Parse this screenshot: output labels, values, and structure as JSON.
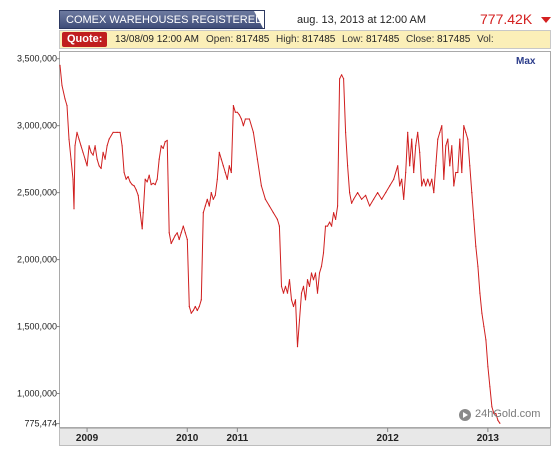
{
  "header": {
    "title": "COMEX WAREHOUSES REGISTERED S",
    "datetime": "aug. 13, 2013 at 12:00 AM",
    "price": "777.42K"
  },
  "quote": {
    "label": "Quote:",
    "date": "13/08/09 12:00 AM",
    "open_label": "Open:",
    "open": "817485",
    "high_label": "High:",
    "high": "817485",
    "low_label": "Low:",
    "low": "817485",
    "close_label": "Close:",
    "close": "817485",
    "vol_label": "Vol:"
  },
  "controls": {
    "max_label": "Max"
  },
  "watermark": "24hGold.com",
  "colors": {
    "line": "#d01f1f",
    "header_bg": "#4a5783",
    "quote_bg": "#fbefb8",
    "quote_label_bg": "#c01e1e",
    "price": "#d42020"
  },
  "chart_data": {
    "type": "line",
    "title": "",
    "xlabel": "",
    "ylabel": "",
    "y_tick_labels": [
      "3,500,000",
      "3,000,000",
      "2,500,000",
      "2,000,000",
      "1,500,000",
      "1,000,000",
      "775,474"
    ],
    "y_tick_values": [
      3500000,
      3000000,
      2500000,
      2000000,
      1500000,
      1000000,
      775474
    ],
    "x_tick_labels": [
      "2009",
      "2010",
      "2011",
      "2012",
      "2013"
    ],
    "x_tick_values": [
      2009.0,
      2010.0,
      2010.5,
      2012.0,
      2013.0
    ],
    "xlim": [
      2008.73,
      2013.62
    ],
    "ylim": [
      750000,
      3550000
    ],
    "grid": false,
    "series": [
      {
        "values": [
          [
            2008.73,
            3450000
          ],
          [
            2008.75,
            3300000
          ],
          [
            2008.78,
            3200000
          ],
          [
            2008.8,
            3150000
          ],
          [
            2008.82,
            2900000
          ],
          [
            2008.84,
            2750000
          ],
          [
            2008.86,
            2600000
          ],
          [
            2008.87,
            2380000
          ],
          [
            2008.88,
            2850000
          ],
          [
            2008.9,
            2950000
          ],
          [
            2008.92,
            2900000
          ],
          [
            2008.94,
            2850000
          ],
          [
            2008.96,
            2800000
          ],
          [
            2008.98,
            2750000
          ],
          [
            2009.0,
            2700000
          ],
          [
            2009.02,
            2850000
          ],
          [
            2009.04,
            2800000
          ],
          [
            2009.06,
            2780000
          ],
          [
            2009.08,
            2850000
          ],
          [
            2009.1,
            2750000
          ],
          [
            2009.12,
            2700000
          ],
          [
            2009.14,
            2680000
          ],
          [
            2009.16,
            2800000
          ],
          [
            2009.18,
            2750000
          ],
          [
            2009.2,
            2850000
          ],
          [
            2009.22,
            2900000
          ],
          [
            2009.26,
            2950000
          ],
          [
            2009.3,
            2950000
          ],
          [
            2009.33,
            2950000
          ],
          [
            2009.35,
            2850000
          ],
          [
            2009.37,
            2650000
          ],
          [
            2009.39,
            2600000
          ],
          [
            2009.41,
            2620000
          ],
          [
            2009.43,
            2580000
          ],
          [
            2009.45,
            2560000
          ],
          [
            2009.47,
            2550000
          ],
          [
            2009.49,
            2520000
          ],
          [
            2009.51,
            2480000
          ],
          [
            2009.53,
            2350000
          ],
          [
            2009.55,
            2230000
          ],
          [
            2009.56,
            2350000
          ],
          [
            2009.58,
            2600000
          ],
          [
            2009.6,
            2580000
          ],
          [
            2009.62,
            2630000
          ],
          [
            2009.64,
            2560000
          ],
          [
            2009.66,
            2570000
          ],
          [
            2009.68,
            2560000
          ],
          [
            2009.7,
            2600000
          ],
          [
            2009.72,
            2750000
          ],
          [
            2009.74,
            2850000
          ],
          [
            2009.76,
            2830000
          ],
          [
            2009.78,
            2880000
          ],
          [
            2009.8,
            2890000
          ],
          [
            2009.82,
            2200000
          ],
          [
            2009.84,
            2120000
          ],
          [
            2009.86,
            2150000
          ],
          [
            2009.88,
            2180000
          ],
          [
            2009.9,
            2200000
          ],
          [
            2009.92,
            2150000
          ],
          [
            2009.94,
            2200000
          ],
          [
            2009.96,
            2250000
          ],
          [
            2009.98,
            2200000
          ],
          [
            2010.0,
            2150000
          ],
          [
            2010.02,
            1650000
          ],
          [
            2010.04,
            1600000
          ],
          [
            2010.06,
            1620000
          ],
          [
            2010.08,
            1650000
          ],
          [
            2010.1,
            1620000
          ],
          [
            2010.12,
            1650000
          ],
          [
            2010.14,
            1700000
          ],
          [
            2010.16,
            2350000
          ],
          [
            2010.18,
            2400000
          ],
          [
            2010.2,
            2450000
          ],
          [
            2010.22,
            2400000
          ],
          [
            2010.24,
            2500000
          ],
          [
            2010.26,
            2450000
          ],
          [
            2010.28,
            2480000
          ],
          [
            2010.3,
            2600000
          ],
          [
            2010.32,
            2800000
          ],
          [
            2010.34,
            2750000
          ],
          [
            2010.36,
            2700000
          ],
          [
            2010.38,
            2650000
          ],
          [
            2010.4,
            2600000
          ],
          [
            2010.42,
            2700000
          ],
          [
            2010.44,
            2650000
          ],
          [
            2010.46,
            3150000
          ],
          [
            2010.48,
            3100000
          ],
          [
            2010.5,
            3100000
          ],
          [
            2010.52,
            3080000
          ],
          [
            2010.54,
            3050000
          ],
          [
            2010.56,
            3000000
          ],
          [
            2010.58,
            3050000
          ],
          [
            2010.62,
            3050000
          ],
          [
            2010.66,
            2950000
          ],
          [
            2010.7,
            2750000
          ],
          [
            2010.74,
            2550000
          ],
          [
            2010.78,
            2450000
          ],
          [
            2010.82,
            2400000
          ],
          [
            2010.86,
            2350000
          ],
          [
            2010.9,
            2300000
          ],
          [
            2010.92,
            2250000
          ],
          [
            2010.94,
            1800000
          ],
          [
            2010.96,
            1750000
          ],
          [
            2010.98,
            1800000
          ],
          [
            2011.0,
            1750000
          ],
          [
            2011.02,
            1850000
          ],
          [
            2011.04,
            1700000
          ],
          [
            2011.06,
            1650000
          ],
          [
            2011.08,
            1700000
          ],
          [
            2011.1,
            1350000
          ],
          [
            2011.12,
            1550000
          ],
          [
            2011.14,
            1750000
          ],
          [
            2011.16,
            1800000
          ],
          [
            2011.18,
            1700000
          ],
          [
            2011.2,
            1850000
          ],
          [
            2011.22,
            1800000
          ],
          [
            2011.24,
            1900000
          ],
          [
            2011.26,
            1850000
          ],
          [
            2011.28,
            1900000
          ],
          [
            2011.3,
            1750000
          ],
          [
            2011.32,
            1900000
          ],
          [
            2011.34,
            1950000
          ],
          [
            2011.36,
            2050000
          ],
          [
            2011.38,
            2250000
          ],
          [
            2011.4,
            2250000
          ],
          [
            2011.42,
            2280000
          ],
          [
            2011.44,
            2250000
          ],
          [
            2011.46,
            2350000
          ],
          [
            2011.48,
            2300000
          ],
          [
            2011.5,
            2400000
          ],
          [
            2011.52,
            3350000
          ],
          [
            2011.54,
            3380000
          ],
          [
            2011.56,
            3350000
          ],
          [
            2011.58,
            2950000
          ],
          [
            2011.6,
            2700000
          ],
          [
            2011.62,
            2500000
          ],
          [
            2011.64,
            2420000
          ],
          [
            2011.66,
            2450000
          ],
          [
            2011.7,
            2500000
          ],
          [
            2011.74,
            2450000
          ],
          [
            2011.78,
            2480000
          ],
          [
            2011.82,
            2400000
          ],
          [
            2011.86,
            2450000
          ],
          [
            2011.9,
            2500000
          ],
          [
            2011.94,
            2450000
          ],
          [
            2011.98,
            2500000
          ],
          [
            2012.02,
            2550000
          ],
          [
            2012.06,
            2600000
          ],
          [
            2012.1,
            2700000
          ],
          [
            2012.12,
            2550000
          ],
          [
            2012.14,
            2600000
          ],
          [
            2012.16,
            2450000
          ],
          [
            2012.18,
            2650000
          ],
          [
            2012.2,
            2950000
          ],
          [
            2012.22,
            2700000
          ],
          [
            2012.24,
            2900000
          ],
          [
            2012.26,
            2650000
          ],
          [
            2012.28,
            2850000
          ],
          [
            2012.3,
            2950000
          ],
          [
            2012.32,
            2800000
          ],
          [
            2012.34,
            2550000
          ],
          [
            2012.36,
            2600000
          ],
          [
            2012.38,
            2550000
          ],
          [
            2012.4,
            2600000
          ],
          [
            2012.42,
            2550000
          ],
          [
            2012.44,
            2600000
          ],
          [
            2012.46,
            2500000
          ],
          [
            2012.48,
            2700000
          ],
          [
            2012.5,
            2900000
          ],
          [
            2012.52,
            2950000
          ],
          [
            2012.54,
            3000000
          ],
          [
            2012.56,
            2600000
          ],
          [
            2012.58,
            2850000
          ],
          [
            2012.6,
            2900000
          ],
          [
            2012.62,
            2700000
          ],
          [
            2012.64,
            2850000
          ],
          [
            2012.66,
            2550000
          ],
          [
            2012.68,
            2650000
          ],
          [
            2012.7,
            2650000
          ],
          [
            2012.72,
            2900000
          ],
          [
            2012.74,
            2650000
          ],
          [
            2012.76,
            3000000
          ],
          [
            2012.78,
            2950000
          ],
          [
            2012.8,
            2900000
          ],
          [
            2012.82,
            2700000
          ],
          [
            2012.84,
            2500000
          ],
          [
            2012.86,
            2300000
          ],
          [
            2012.88,
            2100000
          ],
          [
            2012.9,
            1950000
          ],
          [
            2012.92,
            1750000
          ],
          [
            2012.94,
            1600000
          ],
          [
            2012.96,
            1500000
          ],
          [
            2012.98,
            1400000
          ],
          [
            2013.0,
            1200000
          ],
          [
            2013.02,
            1050000
          ],
          [
            2013.04,
            900000
          ],
          [
            2013.06,
            850000
          ],
          [
            2013.08,
            850000
          ],
          [
            2013.1,
            800000
          ],
          [
            2013.12,
            777420
          ]
        ]
      }
    ]
  }
}
